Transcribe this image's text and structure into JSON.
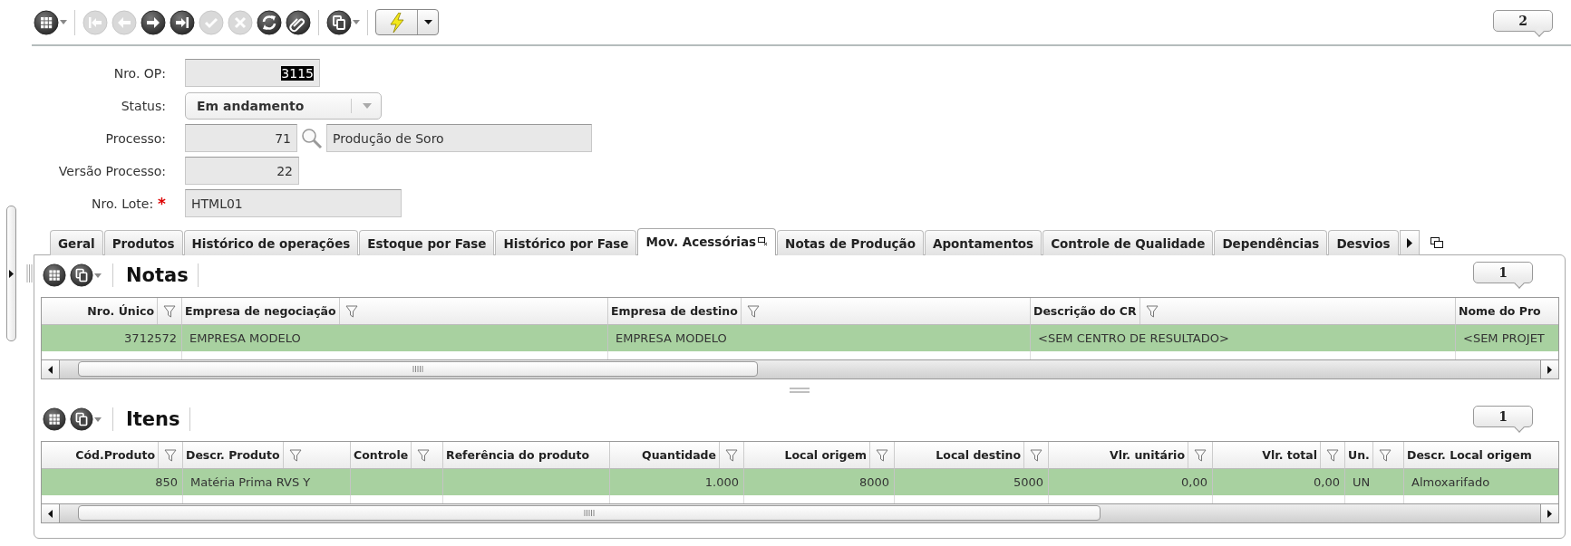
{
  "toolbar": {
    "groups": [
      [
        {
          "kind": "grid",
          "disabled": false,
          "dropdown": true
        }
      ],
      [
        {
          "kind": "first",
          "disabled": true,
          "dropdown": false
        },
        {
          "kind": "prev",
          "disabled": true,
          "dropdown": false
        },
        {
          "kind": "next",
          "disabled": false,
          "dropdown": false
        },
        {
          "kind": "last",
          "disabled": false,
          "dropdown": false
        },
        {
          "kind": "confirm",
          "disabled": true,
          "dropdown": false
        },
        {
          "kind": "cancel",
          "disabled": true,
          "dropdown": false
        },
        {
          "kind": "refresh",
          "disabled": false,
          "dropdown": false
        },
        {
          "kind": "attach",
          "disabled": false,
          "dropdown": false
        }
      ],
      [
        {
          "kind": "copy",
          "disabled": false,
          "dropdown": true
        }
      ],
      [
        {
          "kind": "action",
          "disabled": false,
          "dropdown": true
        }
      ]
    ],
    "record_count": "2"
  },
  "form": {
    "fields": [
      {
        "label": "Nro. OP:",
        "kind": "number",
        "value": "3115",
        "text_selected": true
      },
      {
        "label": "Status:",
        "kind": "select",
        "value": "Em andamento",
        "text_selected": false
      },
      {
        "label": "Processo:",
        "kind": "lookup",
        "value": "71",
        "description": "Produção de Soro",
        "text_selected": false
      },
      {
        "label": "Versão Processo:",
        "kind": "number",
        "value": "22",
        "text_selected": false
      },
      {
        "label": "Nro. Lote:",
        "kind": "text",
        "value": "HTML01",
        "text_selected": false,
        "required_mark": "*"
      }
    ]
  },
  "tabs": [
    {
      "label": "Geral",
      "selected": false
    },
    {
      "label": "Produtos",
      "selected": false
    },
    {
      "label": "Histórico de operações",
      "selected": false
    },
    {
      "label": "Estoque por Fase",
      "selected": false
    },
    {
      "label": "Histórico por Fase",
      "selected": false
    },
    {
      "label": "Mov. Acessórias",
      "selected": true
    },
    {
      "label": "Notas de Produção",
      "selected": false
    },
    {
      "label": "Apontamentos",
      "selected": false
    },
    {
      "label": "Controle de Qualidade",
      "selected": false
    },
    {
      "label": "Dependências",
      "selected": false
    },
    {
      "label": "Desvios",
      "selected": false
    }
  ],
  "sections": [
    {
      "title": "Notas",
      "record_count": "1",
      "toolbar": [
        {
          "kind": "grid",
          "disabled": false,
          "dropdown": false
        },
        {
          "kind": "copy",
          "disabled": false,
          "dropdown": true
        }
      ],
      "columns": [
        {
          "label": "Nro. Único",
          "filter": true
        },
        {
          "label": "Empresa de negociação",
          "filter": true
        },
        {
          "label": "Empresa de destino",
          "filter": true
        },
        {
          "label": "Descrição do CR",
          "filter": true
        },
        {
          "label": "Nome do Pro",
          "filter": false
        }
      ],
      "rows": [
        {
          "selected": true,
          "cells": [
            "3712572",
            "EMPRESA MODELO",
            "EMPRESA MODELO",
            "<SEM CENTRO DE RESULTADO>",
            "<SEM PROJET"
          ]
        }
      ]
    },
    {
      "title": "Itens",
      "record_count": "1",
      "toolbar": [
        {
          "kind": "grid",
          "disabled": false,
          "dropdown": false
        },
        {
          "kind": "copy",
          "disabled": false,
          "dropdown": true
        }
      ],
      "columns": [
        {
          "label": "Cód.Produto",
          "filter": true
        },
        {
          "label": "Descr. Produto",
          "filter": true
        },
        {
          "label": "Controle",
          "filter": true
        },
        {
          "label": "Referência do produto",
          "filter": false
        },
        {
          "label": "Quantidade",
          "filter": true
        },
        {
          "label": "Local origem",
          "filter": true
        },
        {
          "label": "Local destino",
          "filter": true
        },
        {
          "label": "Vlr. unitário",
          "filter": true
        },
        {
          "label": "Vlr. total",
          "filter": true
        },
        {
          "label": "Un.",
          "filter": true
        },
        {
          "label": "Descr. Local origem",
          "filter": false
        }
      ],
      "rows": [
        {
          "selected": true,
          "cells": [
            "850",
            "Matéria Prima RVS Y",
            "",
            "",
            "1.000",
            "8000",
            "5000",
            "0,00",
            "0,00",
            "UN",
            "Almoxarifado"
          ]
        }
      ]
    }
  ]
}
